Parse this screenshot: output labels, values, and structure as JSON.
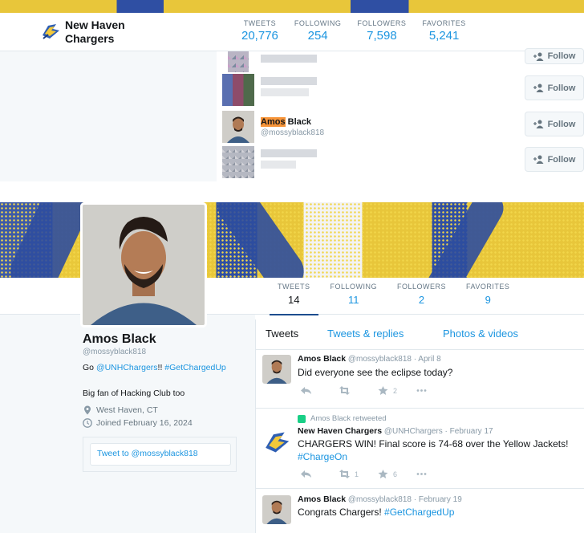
{
  "top": {
    "account_name": "New Haven Chargers",
    "stats": [
      {
        "label": "TWEETS",
        "value": "20,776"
      },
      {
        "label": "FOLLOWING",
        "value": "254"
      },
      {
        "label": "FOLLOWERS",
        "value": "7,598"
      },
      {
        "label": "FAVORITES",
        "value": "5,241"
      }
    ],
    "follower_rows": [
      {
        "name": "",
        "handle": "",
        "follow_label": "Follow"
      },
      {
        "name": "",
        "handle": "",
        "follow_label": "Follow"
      },
      {
        "name_highlight": "Amos",
        "name_rest": " Black",
        "handle": "@mossyblack818",
        "follow_label": "Follow"
      },
      {
        "name": "",
        "handle": "",
        "follow_label": "Follow"
      }
    ]
  },
  "profile": {
    "stats": [
      {
        "label": "TWEETS",
        "value": "14"
      },
      {
        "label": "FOLLOWING",
        "value": "11"
      },
      {
        "label": "FOLLOWERS",
        "value": "2"
      },
      {
        "label": "FAVORITES",
        "value": "9"
      }
    ],
    "name": "Amos Black",
    "handle": "@mossyblack818",
    "bio_prefix": "Go ",
    "bio_mention": "@UNHChargers",
    "bio_mid": "!! ",
    "bio_hashtag": "#GetChargedUp",
    "bio_line2": "Big fan of Hacking Club too",
    "location": "West Haven, CT",
    "joined": "Joined February 16, 2024",
    "tweet_to": "Tweet to @mossyblack818"
  },
  "timeline": {
    "tabs": [
      "Tweets",
      "Tweets & replies",
      "Photos & videos"
    ],
    "tweets": [
      {
        "name": "Amos Black",
        "meta": "@mossyblack818 · April 8",
        "text": "Did everyone see the eclipse today?",
        "retweets": "",
        "favorites": "2"
      },
      {
        "retweeted_by": "Amos Black retweeted",
        "name": "New Haven Chargers",
        "meta": "@UNHChargers · February 17",
        "text": "CHARGERS WIN! Final score is 74-68 over the Yellow Jackets!",
        "hashtag": "#ChargeOn",
        "retweets": "1",
        "favorites": "6"
      },
      {
        "name": "Amos Black",
        "meta": "@mossyblack818 · February 19",
        "text": "Congrats Chargers! ",
        "hashtag": "#GetChargedUp"
      }
    ]
  },
  "colors": {
    "accent": "#1b95e0",
    "active_underline": "#1d4d8f",
    "highlight": "#f79438",
    "banner_yellow": "#e8c63a",
    "banner_blue": "#2f4fa3"
  }
}
